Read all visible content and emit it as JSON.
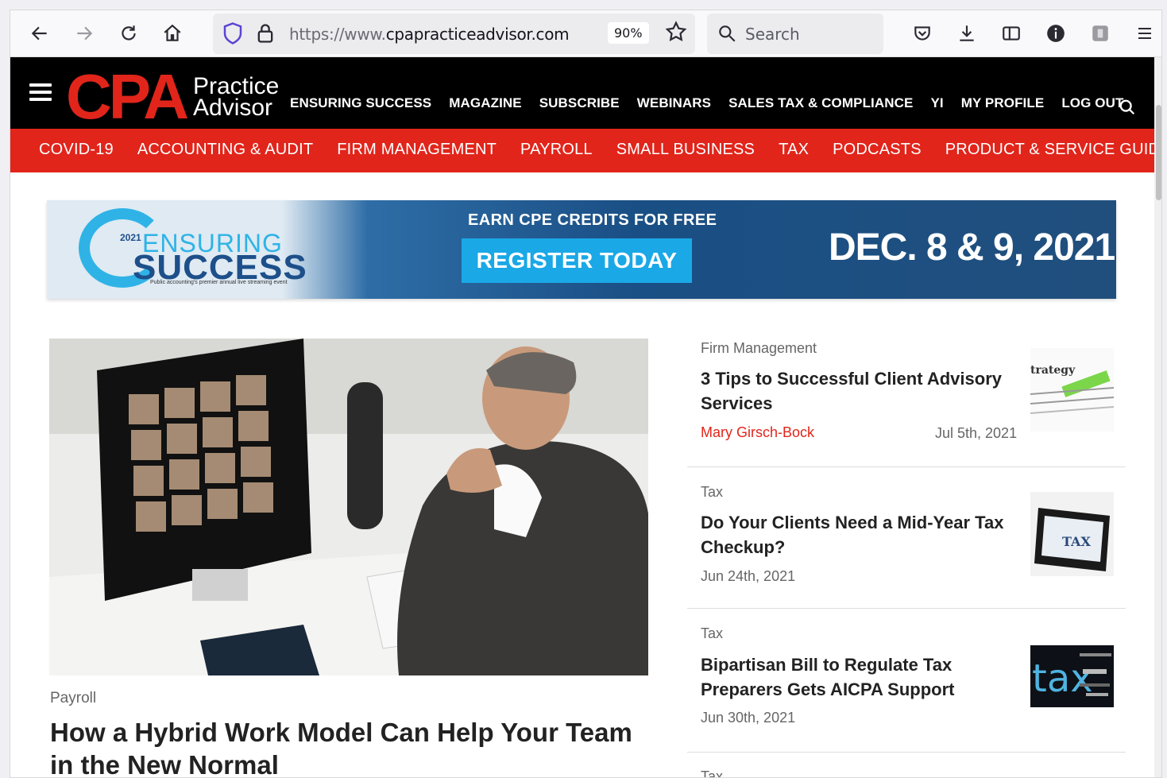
{
  "browser": {
    "url_prefix": "https://www.",
    "url_domain": "cpapracticeadvisor.com",
    "zoom": "90%",
    "search_placeholder": "Search"
  },
  "site": {
    "logo_main": "CPA",
    "logo_sub1": "Practice",
    "logo_sub2": "Advisor",
    "top_nav": [
      "ENSURING SUCCESS",
      "MAGAZINE",
      "SUBSCRIBE",
      "WEBINARS",
      "SALES TAX & COMPLIANCE",
      "YI",
      "MY PROFILE",
      "LOG OUT"
    ],
    "red_nav": [
      "COVID-19",
      "ACCOUNTING & AUDIT",
      "FIRM MANAGEMENT",
      "PAYROLL",
      "SMALL BUSINESS",
      "TAX",
      "PODCASTS",
      "PRODUCT & SERVICE GUIDE"
    ]
  },
  "banner": {
    "year": "2021",
    "logo_line1": "ENSURING",
    "logo_line2": "SUCCESS",
    "tagline": "Public accounting's premier annual live streaming event",
    "earn": "EARN CPE CREDITS FOR FREE",
    "cta": "REGISTER TODAY",
    "date": "DEC. 8 & 9, 2021"
  },
  "feature": {
    "category": "Payroll",
    "title": "How a Hybrid Work Model Can Help Your Team in the New Normal"
  },
  "articles": [
    {
      "category": "Firm Management",
      "title": "3 Tips to Successful Client Advisory Services",
      "author": "Mary Girsch-Bock",
      "date": "Jul 5th, 2021",
      "thumb_text": "trategy"
    },
    {
      "category": "Tax",
      "title": "Do Your Clients Need a Mid-Year Tax Checkup?",
      "author": "",
      "date": "Jun 24th, 2021",
      "thumb_text": "TAX"
    },
    {
      "category": "Tax",
      "title": "Bipartisan Bill to Regulate Tax Preparers Gets AICPA Support",
      "author": "",
      "date": "Jun 30th, 2021",
      "thumb_text": "tax"
    },
    {
      "category": "Tax",
      "title": "",
      "author": "",
      "date": "",
      "thumb_text": ""
    }
  ],
  "colors": {
    "brand_red": "#e1251b",
    "banner_blue": "#1aa8e6",
    "header_black": "#000000"
  }
}
